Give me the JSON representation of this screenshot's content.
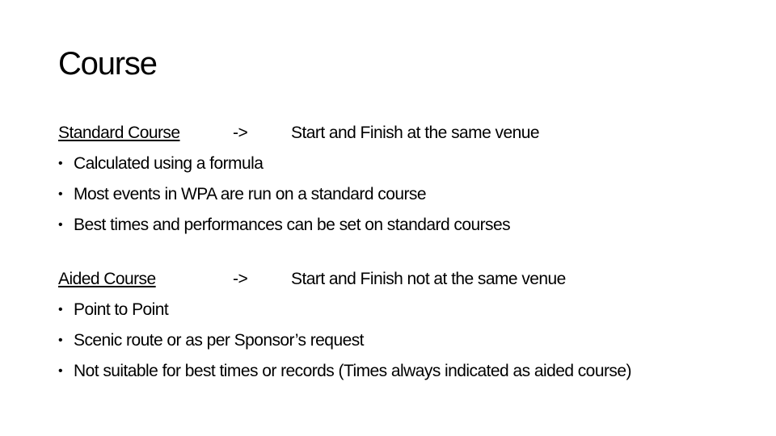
{
  "slide": {
    "title": "Course",
    "sections": [
      {
        "name": "Standard Course",
        "arrow": "->",
        "description": "Start and Finish at the same venue",
        "bullets": [
          "Calculated using a formula",
          "Most events in WPA are run on a standard course",
          "Best times and performances can be set on standard courses"
        ]
      },
      {
        "name": "Aided Course",
        "arrow": "->",
        "description": "Start and Finish not at the same venue",
        "bullets": [
          "Point to Point",
          "Scenic route or as per Sponsor’s request",
          "Not suitable for best times or records (Times always indicated as aided course)"
        ]
      }
    ],
    "bullet_glyph": "•"
  }
}
